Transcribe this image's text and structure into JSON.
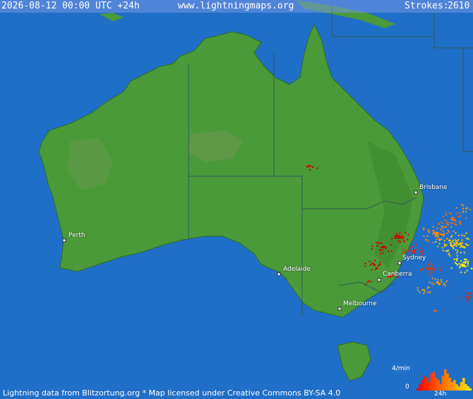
{
  "header": {
    "datetime": "2026-08-12 00:00 UTC +24h",
    "site": "www.lightningmaps.org",
    "strokes_label": "Strokes:",
    "strokes_count": "2610"
  },
  "footer": {
    "attribution": "Lightning data from Blitzortung.org  *  Map licensed under Creative Commons BY-SA 4.0"
  },
  "cities": [
    {
      "name": "Brisbane"
    },
    {
      "name": "Sydney"
    },
    {
      "name": "Canberra"
    },
    {
      "name": "Melbourne"
    },
    {
      "name": "Adelaide"
    },
    {
      "name": "Perth"
    }
  ],
  "legend": {
    "rate_label": "4/min",
    "zero_label": "0",
    "time_label": "24h",
    "histogram_levels": [
      0.1,
      0.3,
      0.5,
      0.7,
      0.6,
      0.4,
      0.8,
      0.9,
      0.6,
      0.5,
      0.3,
      0.7,
      1.0,
      0.8,
      0.6,
      0.4,
      0.5,
      0.3,
      0.2,
      0.4,
      0.6,
      0.3,
      0.2,
      0.1
    ]
  },
  "colors": {
    "ocean": "#1f6fc8",
    "land": "#4a9a3a",
    "recent_strike": "#ffee00",
    "old_strike": "#cc0000"
  }
}
